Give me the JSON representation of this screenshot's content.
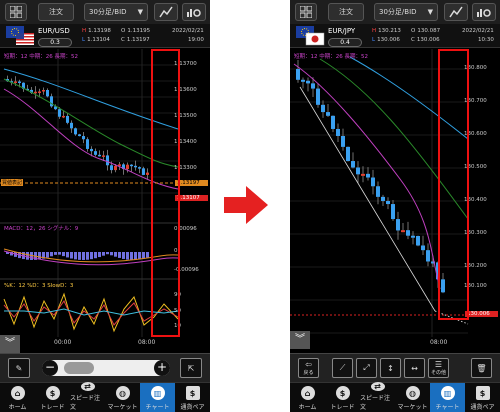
{
  "left": {
    "menu": {
      "order_label": "注文",
      "timeframe_label": "30分足/BID"
    },
    "quote": {
      "pair": "EUR/USD",
      "spread": "0.3",
      "h_label": "H",
      "h_value": "1.13198",
      "l_label": "L",
      "l_value": "1.13104",
      "o_label": "O",
      "o_value": "1.13195",
      "c_label": "C",
      "c_value": "1.13197",
      "date": "2022/02/21",
      "time": "19:00"
    },
    "ma_legend": "短期：12  中期：26  長期：52",
    "axis": [
      "1.13700",
      "1.13600",
      "1.13500",
      "1.13400",
      "1.13300",
      "1.13197",
      "1.13107"
    ],
    "cross_label": "買値表記",
    "macd_label": "MACD：12，26  シグナル：9",
    "macd_axis": [
      "0.00096",
      "0",
      "-0.00096"
    ],
    "stoch_label": "%K：12  %D：3  SlowD：3",
    "stoch_axis": [
      "90",
      "50",
      "10"
    ],
    "time_labels": [
      "00:00",
      "08:00"
    ]
  },
  "right": {
    "menu": {
      "order_label": "注文",
      "timeframe_label": "30分足/BID"
    },
    "quote": {
      "pair": "EUR/JPY",
      "spread": "0.4",
      "h_label": "H",
      "h_value": "130.213",
      "l_label": "L",
      "l_value": "130.006",
      "o_label": "O",
      "o_value": "130.087",
      "c_label": "C",
      "c_value": "130.006",
      "date": "2022/02/21",
      "time": "10:30"
    },
    "ma_legend": "短期：12  中期：26  長期：52",
    "axis": [
      "130.800",
      "130.700",
      "130.600",
      "130.500",
      "130.400",
      "130.300",
      "130.200",
      "130.100",
      "130.006"
    ],
    "time_labels": [
      "08:00"
    ],
    "tools": {
      "back_label": "戻る",
      "other_label": "その他"
    }
  },
  "tabs": [
    "ホーム",
    "トレード",
    "スピード注文",
    "マーケット",
    "チャート",
    "通貨ペア"
  ],
  "colors": {
    "highlight_red": "#e11111",
    "arrow_red": "#e52121",
    "tab_active": "#1a6fc0",
    "candle_up": "#e04030",
    "candle_down": "#3aa0f0"
  }
}
